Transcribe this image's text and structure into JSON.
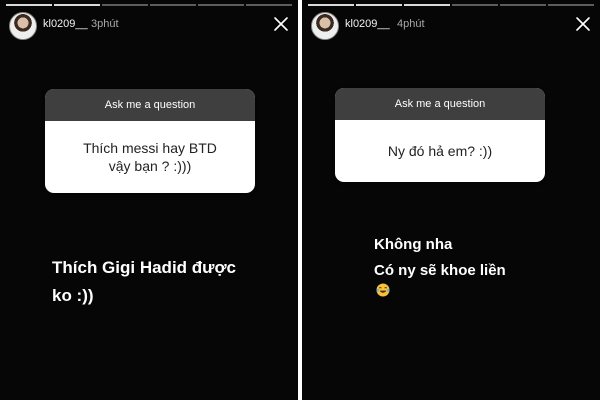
{
  "left_story": {
    "username": "kl0209__",
    "time": "3phút",
    "question_header": "Ask me a question",
    "question": "Thích messi hay BTD\nvậy bạn ? :)))",
    "reply": "Thích Gigi Hadid được\nko :))",
    "progress": {
      "segments": 6,
      "completed": 2
    }
  },
  "right_story": {
    "username": "kl0209__",
    "time": "4phút",
    "question_header": "Ask me a question",
    "question": "Ny đó hả em? :))",
    "reply": "Không nha\nCó ny sẽ khoe liền",
    "emoji": "laughing-with-tears-emoji",
    "progress": {
      "segments": 6,
      "completed": 3
    }
  },
  "icons": {
    "close": "close-icon",
    "avatar": "profile-avatar"
  },
  "colors": {
    "background": "#060606",
    "card_header": "#3f3f3f",
    "card_body": "#ffffff",
    "text_primary": "#ffffff",
    "time_text": "#a8a8a8"
  }
}
